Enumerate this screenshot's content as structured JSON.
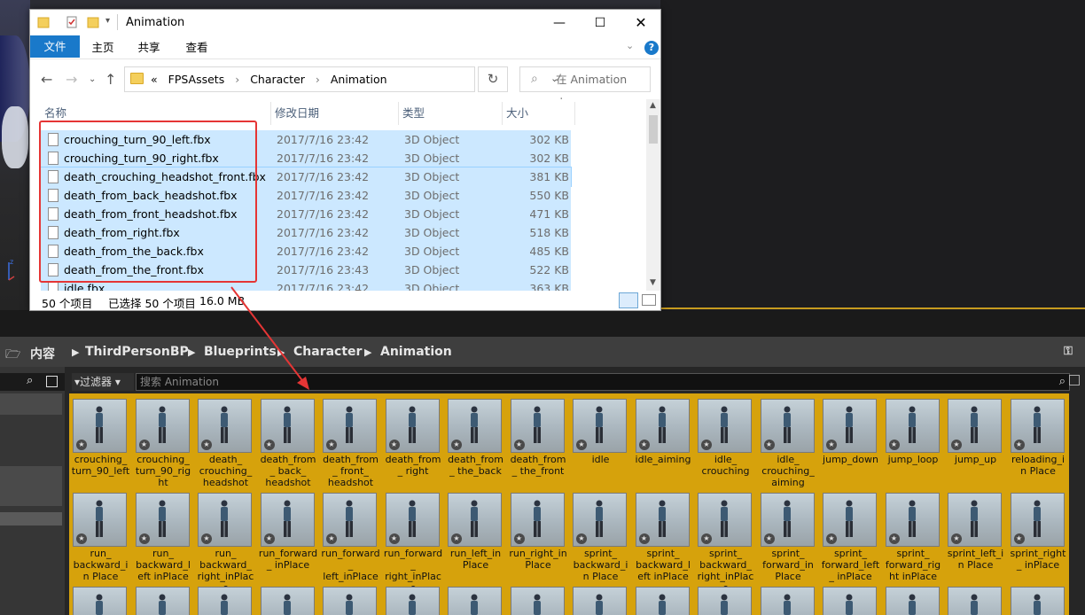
{
  "explorer": {
    "title": "Animation",
    "ribbon_tabs": [
      "文件",
      "主页",
      "共享",
      "查看"
    ],
    "help": "?",
    "address": [
      "FPSAssets",
      "Character",
      "Animation"
    ],
    "address_prefix": "«",
    "search_placeholder": "在 Animation 中...",
    "columns": [
      "名称",
      "修改日期",
      "类型",
      "大小"
    ],
    "files": [
      {
        "name": "crouching_turn_90_left.fbx",
        "date": "2017/7/16 23:42",
        "type": "3D Object",
        "size": "302 KB"
      },
      {
        "name": "crouching_turn_90_right.fbx",
        "date": "2017/7/16 23:42",
        "type": "3D Object",
        "size": "302 KB"
      },
      {
        "name": "death_crouching_headshot_front.fbx",
        "date": "2017/7/16 23:42",
        "type": "3D Object",
        "size": "381 KB"
      },
      {
        "name": "death_from_back_headshot.fbx",
        "date": "2017/7/16 23:42",
        "type": "3D Object",
        "size": "550 KB"
      },
      {
        "name": "death_from_front_headshot.fbx",
        "date": "2017/7/16 23:42",
        "type": "3D Object",
        "size": "471 KB"
      },
      {
        "name": "death_from_right.fbx",
        "date": "2017/7/16 23:42",
        "type": "3D Object",
        "size": "518 KB"
      },
      {
        "name": "death_from_the_back.fbx",
        "date": "2017/7/16 23:42",
        "type": "3D Object",
        "size": "485 KB"
      },
      {
        "name": "death_from_the_front.fbx",
        "date": "2017/7/16 23:43",
        "type": "3D Object",
        "size": "522 KB"
      },
      {
        "name": "idle.fbx",
        "date": "2017/7/16 23:42",
        "type": "3D Object",
        "size": "363 KB"
      }
    ],
    "status_count": "50 个项目",
    "status_selected": "已选择 50 个项目",
    "status_size": "16.0 MB"
  },
  "content_browser": {
    "breadcrumb": [
      "内容",
      "ThirdPersonBP",
      "Blueprints",
      "Character",
      "Animation"
    ],
    "filter_label": "过滤器",
    "search_placeholder": "搜索 Animation",
    "assets_row1": [
      "crouching_ turn_90_left",
      "crouching_ turn_90_right",
      "death_ crouching_ headshot",
      "death_from_ back_ headshot",
      "death_from_ front_ headshot",
      "death_from_ right",
      "death_from_ the_back",
      "death_from_ the_front",
      "idle",
      "idle_aiming",
      "idle_ crouching",
      "idle_ crouching_ aiming",
      "jump_down",
      "jump_loop",
      "jump_up",
      "reloading_in Place"
    ],
    "assets_row2": [
      "run_ backward_in Place",
      "run_ backward_left inPlace",
      "run_ backward_ right_inPlace",
      "run_forward_ inPlace",
      "run_forward_ left_inPlace",
      "run_forward_ right_inPlace",
      "run_left_in Place",
      "run_right_in Place",
      "sprint_ backward_in Place",
      "sprint_ backward_left inPlace",
      "sprint_ backward_ right_inPlace",
      "sprint_ forward_in Place",
      "sprint_ forward_left_ inPlace",
      "sprint_ forward_right inPlace",
      "sprint_left_in Place",
      "sprint_right_ inPlace"
    ]
  },
  "colors": {
    "selection": "#cce8ff",
    "asset_bg": "#d6a20c",
    "annotation": "#e53535"
  }
}
